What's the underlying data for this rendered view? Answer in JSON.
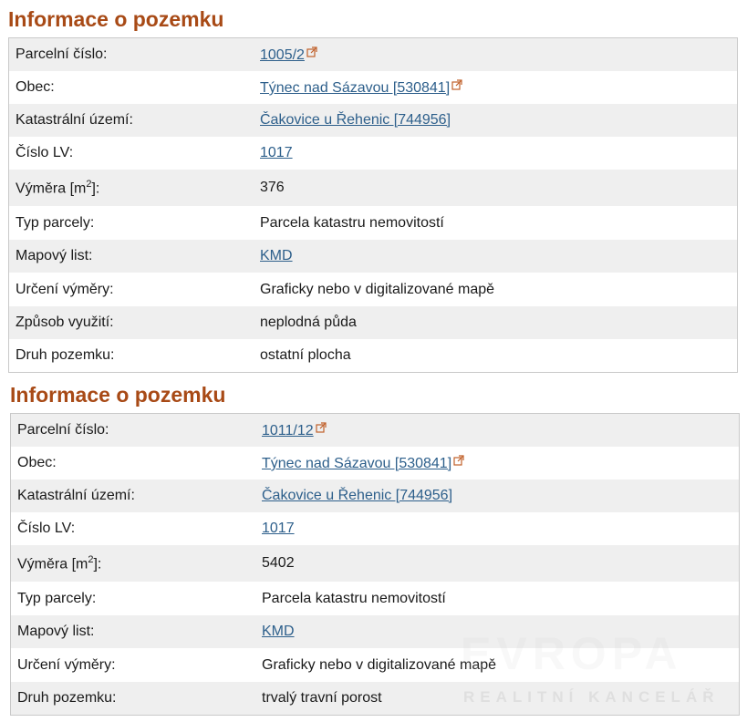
{
  "sections": [
    {
      "title": "Informace o pozemku",
      "rows": {
        "parcel_number": {
          "label": "Parcelní číslo:",
          "value": "1005/2"
        },
        "municipality": {
          "label": "Obec:",
          "value": "Týnec nad Sázavou [530841]"
        },
        "cadastral_area": {
          "label": "Katastrální území:",
          "value": "Čakovice u Řehenic [744956]"
        },
        "lv_number": {
          "label": "Číslo LV:",
          "value": "1017"
        },
        "area": {
          "label_prefix": "Výměra [m",
          "label_sup": "2",
          "label_suffix": "]:",
          "value": "376"
        },
        "parcel_type": {
          "label": "Typ parcely:",
          "value": "Parcela katastru nemovitostí"
        },
        "map_sheet": {
          "label": "Mapový list:",
          "value": "KMD"
        },
        "area_determination": {
          "label": "Určení výměry:",
          "value": "Graficky nebo v digitalizované mapě"
        },
        "usage": {
          "label": "Způsob využití:",
          "value": "neplodná půda"
        },
        "land_kind": {
          "label": "Druh pozemku:",
          "value": "ostatní plocha"
        }
      }
    },
    {
      "title": "Informace o pozemku",
      "rows": {
        "parcel_number": {
          "label": "Parcelní číslo:",
          "value": "1011/12"
        },
        "municipality": {
          "label": "Obec:",
          "value": "Týnec nad Sázavou [530841]"
        },
        "cadastral_area": {
          "label": "Katastrální území:",
          "value": "Čakovice u Řehenic [744956]"
        },
        "lv_number": {
          "label": "Číslo LV:",
          "value": "1017"
        },
        "area": {
          "label_prefix": "Výměra [m",
          "label_sup": "2",
          "label_suffix": "]:",
          "value": "5402"
        },
        "parcel_type": {
          "label": "Typ parcely:",
          "value": "Parcela katastru nemovitostí"
        },
        "map_sheet": {
          "label": "Mapový list:",
          "value": "KMD"
        },
        "area_determination": {
          "label": "Určení výměry:",
          "value": "Graficky nebo v digitalizované mapě"
        },
        "land_kind": {
          "label": "Druh pozemku:",
          "value": "trvalý travní porost"
        }
      }
    }
  ],
  "watermark": {
    "brand": "EVROPA",
    "tagline": "REALITNÍ KANCELÁŘ"
  },
  "colors": {
    "heading": "#a84a16",
    "link": "#2d5f8b",
    "row_alt": "#efefef",
    "ext_icon": "#c0602a"
  }
}
